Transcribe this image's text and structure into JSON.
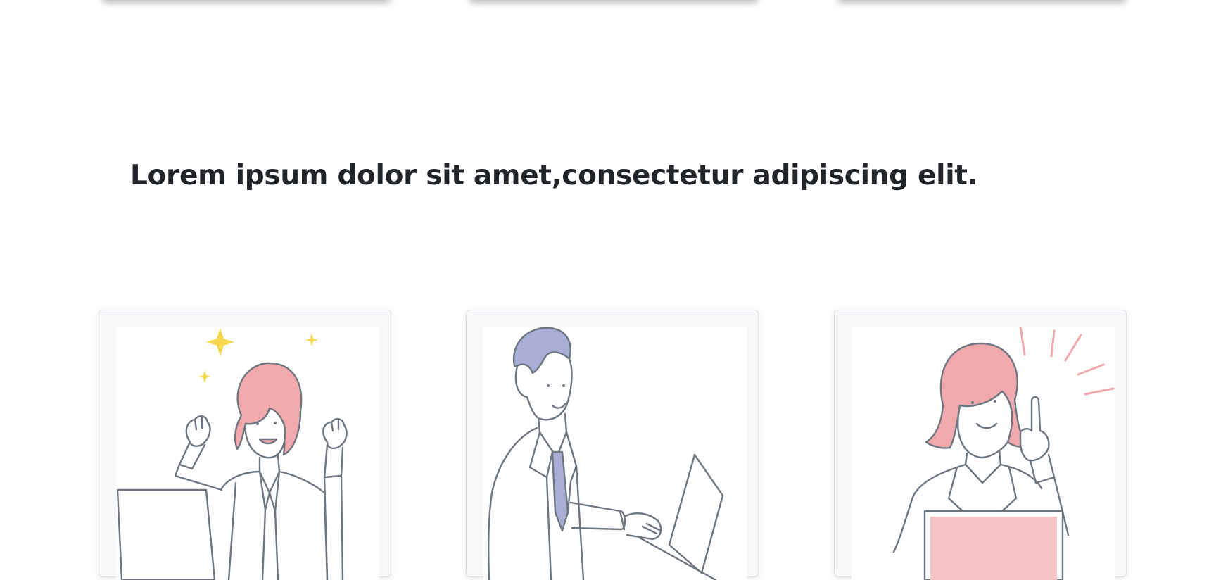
{
  "section": {
    "heading": "Lorem ipsum dolor sit amet,consectetur adipiscing elit."
  },
  "cards": [
    {
      "illustration": "celebrating-woman-illustration"
    },
    {
      "illustration": "typing-man-illustration"
    },
    {
      "illustration": "idea-woman-illustration"
    }
  ],
  "colors": {
    "text": "#212529",
    "line": "#6e7680",
    "hair_pink": "#f2a9ae",
    "hair_lavender": "#a9aed6",
    "sparkle": "#f6d84e",
    "laptop_pink": "#f4c4c7",
    "card_bg": "#f7f8fa"
  }
}
